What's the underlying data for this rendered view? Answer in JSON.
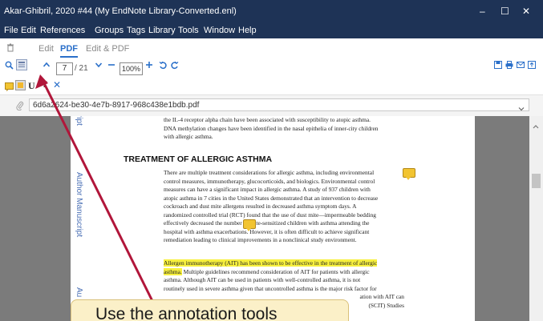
{
  "window": {
    "title": "Akar-Ghibril, 2020 #44 (My EndNote Library-Converted.enl)",
    "minimize": "–",
    "maximize": "☐",
    "close": "✕"
  },
  "menu": [
    "File",
    "Edit",
    "References",
    "Groups",
    "Tags",
    "Library",
    "Tools",
    "Window",
    "Help"
  ],
  "tabs": {
    "edit": "Edit",
    "pdf": "PDF",
    "edit_pdf": "Edit & PDF"
  },
  "toolbar": {
    "page": "7",
    "page_total": "/ 21",
    "zoom": "100%"
  },
  "file": {
    "name": "6d6a2624-be30-4e7b-8917-968c438e1bdb.pdf"
  },
  "document": {
    "side_labels": [
      "ript",
      "Author Manuscript",
      "Au"
    ],
    "para1": [
      "the IL-4 receptor alpha chain have been associated with susceptibility to atopic asthma.",
      "DNA methylation changes have been identified in the nasal epithelia of inner-city children",
      "with allergic asthma."
    ],
    "heading": "TREATMENT OF ALLERGIC ASTHMA",
    "para2": [
      "There are multiple treatment considerations for allergic asthma, including environmental",
      "control measures, immunotherapy, glucocorticoids, and biologics. Environmental control",
      "measures can have a significant impact in allergic asthma. A study of 937 children with",
      "atopic asthma in 7 cities in the United States demonstrated that an intervention to decrease",
      "cockroach and dust mite allergens resulted in decreased asthma symptom days. A",
      "randomized controlled trial (RCT) found that the use of dust mite—impermeable bedding",
      "effectively decreased the number of mite-sensitized children with asthma attending the",
      "hospital with asthma exacerbations. However, it is often difficult to achieve significant",
      "remediation leading to clinical improvements in a nonclinical study environment."
    ],
    "para3_highlight_a": "Allergen immunotherapy (AIT) has been shown to be effective in the treatment of allergic",
    "para3_highlight_b": "asthma.",
    "para3_rest_a": " Multiple guidelines recommend consideration of AIT for patients with allergic",
    "para3": [
      "asthma. Although AIT can be used in patients with well-controlled asthma, it is not",
      "routinely used in severe asthma given that uncontrolled asthma is the major risk factor for",
      "ation with AIT can",
      "(SCIT) Studies"
    ]
  },
  "callout": {
    "text": "Use the annotation tools"
  },
  "colors": {
    "titlebar": "#1e3356",
    "accent": "#2a6fc9",
    "highlight": "#f7f03e",
    "arrow": "#b1163a",
    "callout": "#fbf0c8"
  }
}
